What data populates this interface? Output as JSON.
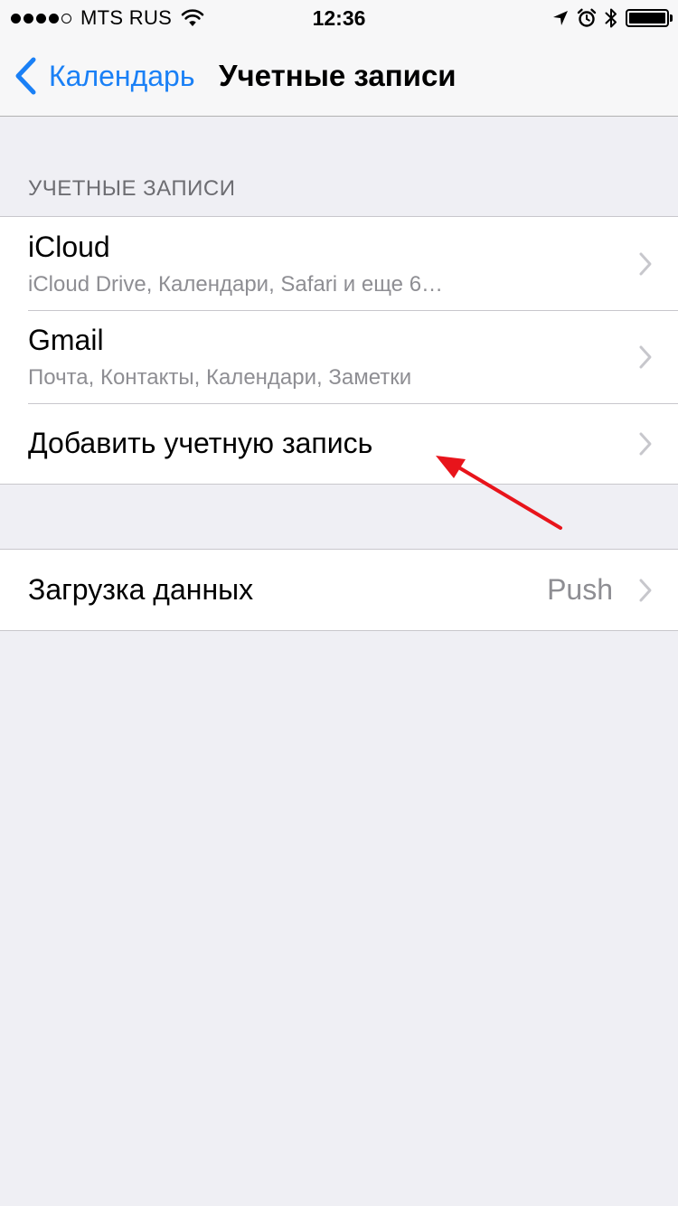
{
  "status_bar": {
    "carrier": "MTS RUS",
    "time": "12:36",
    "signal_bars_filled": 4,
    "signal_bars_total": 5,
    "icons": [
      "wifi-icon",
      "location-arrow-icon",
      "alarm-icon",
      "bluetooth-icon",
      "battery-icon"
    ]
  },
  "nav": {
    "back_label": "Календарь",
    "title": "Учетные записи"
  },
  "accounts_section": {
    "header": "УЧЕТНЫЕ ЗАПИСИ",
    "rows": [
      {
        "title": "iCloud",
        "subtitle": "iCloud Drive, Календари, Safari и еще 6…"
      },
      {
        "title": "Gmail",
        "subtitle": "Почта, Контакты, Календари, Заметки"
      },
      {
        "title": "Добавить учетную запись"
      }
    ]
  },
  "fetch_section": {
    "rows": [
      {
        "title": "Загрузка данных",
        "detail": "Push"
      }
    ]
  },
  "colors": {
    "accent": "#1a80f6",
    "background": "#efeff4",
    "secondary_text": "#8e8e93",
    "annotation_arrow": "#e8141b"
  }
}
